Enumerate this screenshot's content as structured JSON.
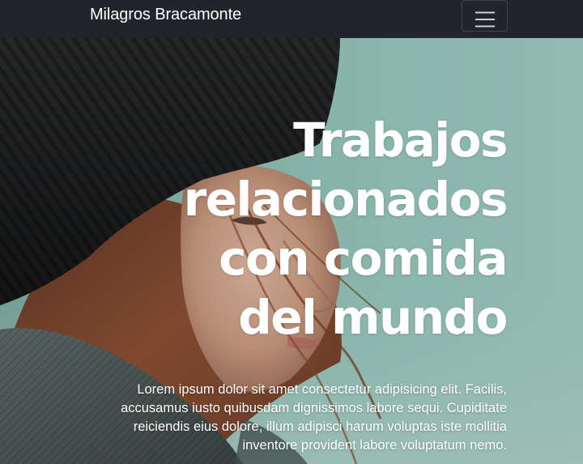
{
  "navbar": {
    "brand": "Milagros Bracamonte",
    "toggle_icon": "hamburger-menu-icon"
  },
  "hero": {
    "background_image": "woman-in-black-beanie-and-grey-scarf-photo",
    "heading": "Trabajos relacionados con comida del mundo",
    "lead": "Lorem ipsum dolor sit amet consectetur adipisicing elit. Facilis, accusamus iusto quibusdam dignissimos labore sequi. Cupiditate reiciendis eius dolore, illum adipisci harum voluptas iste mollitia inventore provident labore voluptatum nemo."
  },
  "colors": {
    "navbar_bg": "#212529",
    "hero_text": "#ffffff",
    "hero_bg_teal": "#8fbfb4"
  }
}
